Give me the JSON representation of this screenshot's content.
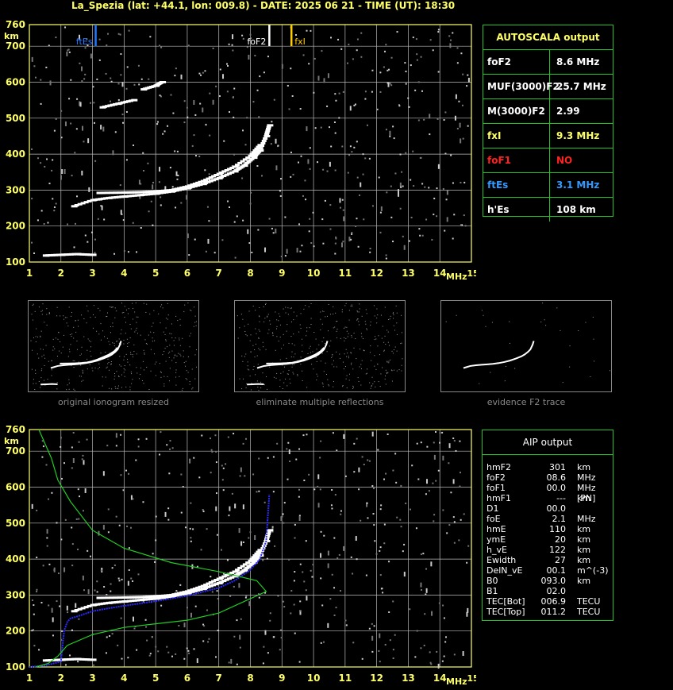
{
  "header": "La_Spezia (lat: +44.1, lon: 009.8) - DATE: 2025 06 21 - TIME (UT): 18:30",
  "colors": {
    "axis": "#ffff66",
    "grid": "#bbbbbb",
    "table_border": "#22c322",
    "trace": "#ffffff",
    "foF2_marker": "#ffffff",
    "fxI_marker": "#ffcc00",
    "ftEs_marker": "#2277ff",
    "aip_profile": "#2a2aff",
    "aip_density": "#22cc22"
  },
  "autoscala": {
    "title": "AUTOSCALA output",
    "rows": [
      {
        "label": "foF2",
        "value": "8.6 MHz",
        "color": "#ffffff"
      },
      {
        "label": "MUF(3000)F2",
        "value": "25.7 MHz",
        "color": "#ffffff"
      },
      {
        "label": "M(3000)F2",
        "value": "2.99",
        "color": "#ffffff"
      },
      {
        "label": "fxI",
        "value": "9.3 MHz",
        "color": "#ffff66"
      },
      {
        "label": "foF1",
        "value": "NO",
        "color": "#ff2222"
      },
      {
        "label": "ftEs",
        "value": "3.1 MHz",
        "color": "#3399ff"
      },
      {
        "label": "h'Es",
        "value": "108     km",
        "color": "#ffffff"
      }
    ]
  },
  "aip": {
    "title": "AIP output",
    "rows": [
      [
        "hmF2",
        "301",
        "km"
      ],
      [
        "foF2",
        "08.6",
        "MHz"
      ],
      [
        "foF1",
        "00.0",
        "MHz   [PN]"
      ],
      [
        "hmF1",
        "---",
        "km"
      ],
      [
        "D1",
        "00.0",
        ""
      ],
      [
        "foE",
        "2.1",
        "MHz"
      ],
      [
        "hmE",
        "110",
        "km"
      ],
      [
        "ymE",
        "20",
        "km"
      ],
      [
        "h_vE",
        "122",
        "km"
      ],
      [
        "Ewidth",
        "27",
        "km"
      ],
      [
        "DelN_vE",
        "00.1",
        "m^(-3)"
      ],
      [
        "B0",
        "093.0",
        "km"
      ],
      [
        "B1",
        "02.0",
        ""
      ],
      [
        "TEC[Bot]",
        "006.9",
        "TECU"
      ],
      [
        "TEC[Top]",
        "011.2",
        "TECU"
      ]
    ]
  },
  "thumb_captions": [
    "original ionogram resized",
    "eliminate multiple reflections",
    "evidence F2 trace"
  ],
  "chart_data": [
    {
      "type": "scatter",
      "title": "",
      "xlabel": "MHz",
      "ylabel": "km",
      "xlim": [
        1,
        15
      ],
      "ylim": [
        100,
        760
      ],
      "xticks": [
        1,
        2,
        3,
        4,
        5,
        6,
        7,
        8,
        9,
        10,
        11,
        12,
        13,
        14,
        15
      ],
      "yticks": [
        100,
        200,
        300,
        400,
        500,
        600,
        700,
        760
      ],
      "grid": true,
      "markers": [
        {
          "name": "ftEs",
          "x": 3.1,
          "color": "#2277ff"
        },
        {
          "name": "foF2",
          "x": 8.6,
          "color": "#ffffff"
        },
        {
          "name": "fxI",
          "x": 9.3,
          "color": "#ffcc00"
        }
      ],
      "series": [
        {
          "x": [
            2.4,
            3.0,
            3.5,
            4.0,
            4.5,
            5.0,
            5.5,
            6.0,
            6.5,
            7.0,
            7.5,
            7.8,
            8.1,
            8.3,
            8.5,
            8.6
          ],
          "y": [
            255,
            272,
            278,
            282,
            286,
            290,
            296,
            305,
            317,
            333,
            352,
            368,
            390,
            410,
            450,
            480
          ]
        },
        {
          "x": [
            3.2,
            4.0,
            4.5,
            5.0,
            5.5,
            6.0,
            6.5,
            7.0,
            7.5,
            8.0,
            8.3
          ],
          "y": [
            292,
            293,
            294,
            296,
            300,
            310,
            325,
            345,
            365,
            395,
            425
          ]
        },
        {
          "x": [
            1.5,
            2.0,
            2.5,
            3.0
          ],
          "y": [
            118,
            120,
            122,
            120
          ]
        },
        {
          "x": [
            3.3,
            3.8,
            4.3
          ],
          "y": [
            530,
            540,
            550
          ]
        },
        {
          "x": [
            4.6,
            5.0,
            5.2
          ],
          "y": [
            580,
            590,
            600
          ]
        }
      ]
    },
    {
      "type": "line",
      "title": "",
      "xlabel": "MHz",
      "ylabel": "km",
      "xlim": [
        1,
        15
      ],
      "ylim": [
        100,
        760
      ],
      "xticks": [
        1,
        2,
        3,
        4,
        5,
        6,
        7,
        8,
        9,
        10,
        11,
        12,
        13,
        14,
        15
      ],
      "yticks": [
        100,
        200,
        300,
        400,
        500,
        600,
        700,
        760
      ],
      "grid": true,
      "series": [
        {
          "x": [
            2.4,
            3.0,
            3.5,
            4.0,
            4.5,
            5.0,
            5.5,
            6.0,
            6.5,
            7.0,
            7.5,
            7.8,
            8.1,
            8.3,
            8.5,
            8.6
          ],
          "y": [
            255,
            272,
            278,
            282,
            286,
            290,
            296,
            305,
            317,
            333,
            352,
            368,
            390,
            410,
            450,
            480
          ]
        },
        {
          "x": [
            3.2,
            4.0,
            4.5,
            5.0,
            5.5,
            6.0,
            6.5,
            7.0,
            7.5,
            8.0,
            8.3
          ],
          "y": [
            292,
            293,
            294,
            296,
            300,
            310,
            325,
            345,
            365,
            395,
            425
          ]
        },
        {
          "x": [
            1.5,
            2.0,
            2.5,
            3.0
          ],
          "y": [
            118,
            120,
            122,
            120
          ]
        },
        {
          "x": [
            1.0,
            1.5,
            2.0,
            2.1,
            2.2,
            2.3,
            2.5,
            3.0,
            3.5,
            4.0,
            5.0,
            6.0,
            7.0,
            7.5,
            8.0,
            8.3,
            8.5,
            8.6
          ],
          "y": [
            100,
            104,
            115,
            200,
            225,
            235,
            240,
            255,
            263,
            270,
            283,
            298,
            320,
            340,
            370,
            400,
            450,
            580
          ]
        },
        {
          "x": [
            1.2,
            1.6,
            1.9,
            2.2,
            3.0,
            4.0,
            5.0,
            6.0,
            7.0,
            8.0,
            8.5,
            8.2,
            7.0,
            5.5,
            4.0,
            3.0,
            2.3,
            1.9,
            1.7,
            1.5,
            1.3
          ],
          "y": [
            100,
            110,
            130,
            160,
            190,
            210,
            220,
            230,
            250,
            290,
            310,
            340,
            365,
            390,
            430,
            480,
            560,
            620,
            680,
            720,
            760
          ]
        }
      ]
    }
  ]
}
